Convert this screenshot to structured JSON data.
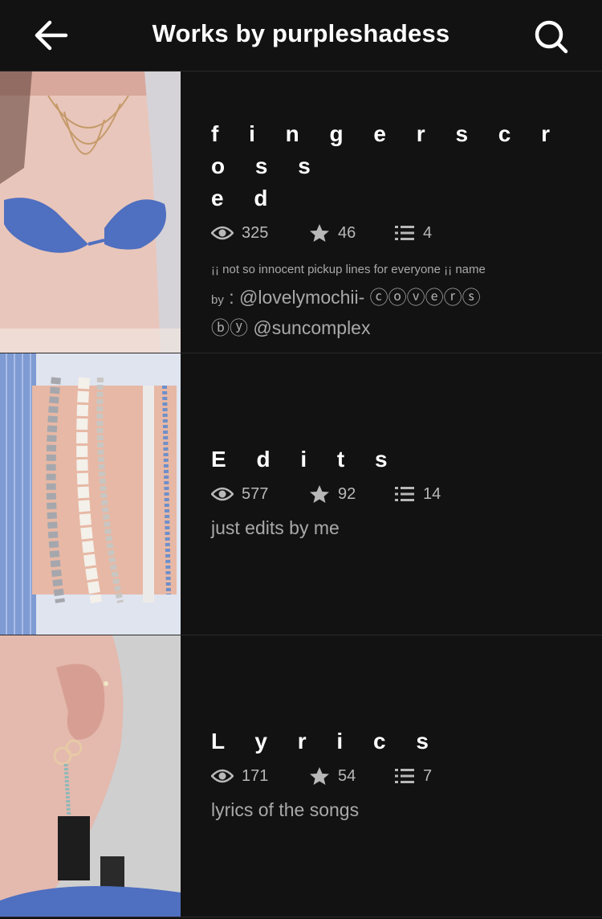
{
  "header": {
    "title": "Works by purpleshadess",
    "back_icon": "arrow-left-icon",
    "search_icon": "search-icon"
  },
  "stories": [
    {
      "title_line1": "f i n g e r s  c r o s s",
      "title_line2": "e d",
      "views": "325",
      "votes": "46",
      "parts": "4",
      "desc_small1": "¡¡ not so innocent pickup lines for everyone ¡¡ name",
      "desc_small2": "by",
      "desc_rest1": ": @lovelymochii- ⓒⓞⓥⓔⓡⓢ",
      "desc_rest2": "ⓑⓨ @suncomplex"
    },
    {
      "title": "E d i t s",
      "views": "577",
      "votes": "92",
      "parts": "14",
      "desc": "just edits by me"
    },
    {
      "title": "L y r i c s",
      "views": "171",
      "votes": "54",
      "parts": "7",
      "desc": "lyrics of the songs"
    }
  ],
  "colors": {
    "background": "#121212",
    "divider": "#2a2a2a",
    "meta_text": "#b8b8b8"
  }
}
